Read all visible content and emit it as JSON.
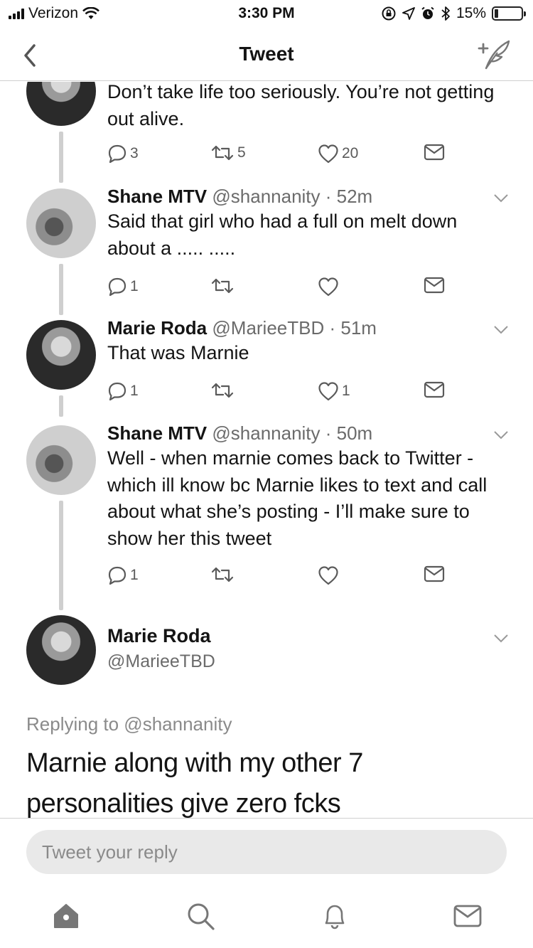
{
  "status_bar": {
    "carrier": "Verizon",
    "time": "3:30 PM",
    "battery": "15%",
    "battery_level": 0.15
  },
  "nav": {
    "title": "Tweet"
  },
  "tweets": [
    {
      "text": "Don’t take life too seriously. You’re not getting out alive.",
      "replies": "3",
      "retweets": "5",
      "likes": "20"
    },
    {
      "name": "Shane MTV",
      "handle": "@shannanity · 52m",
      "text": "Said that girl who had a full on melt down about a ..... .....",
      "replies": "1",
      "retweets": "",
      "likes": ""
    },
    {
      "name": "Marie Roda",
      "handle": "@MarieeTBD · 51m",
      "text": "That was Marnie",
      "replies": "1",
      "retweets": "",
      "likes": "1"
    },
    {
      "name": "Shane MTV",
      "handle": "@shannanity · 50m",
      "text": "Well - when marnie comes back to Twitter - which ill know bc Marnie likes to text and call about what she’s posting - I’ll make sure to show her this tweet",
      "replies": "1",
      "retweets": "",
      "likes": ""
    }
  ],
  "focused": {
    "name": "Marie Roda",
    "handle": "@MarieeTBD",
    "replying_to": "Replying to @shannanity",
    "text": "Marnie along with my other 7 personalities give zero fcks"
  },
  "reply": {
    "placeholder": "Tweet your reply"
  },
  "tab_bar": {
    "icons": [
      "home-icon",
      "search-icon",
      "notifications-icon",
      "messages-icon"
    ]
  }
}
